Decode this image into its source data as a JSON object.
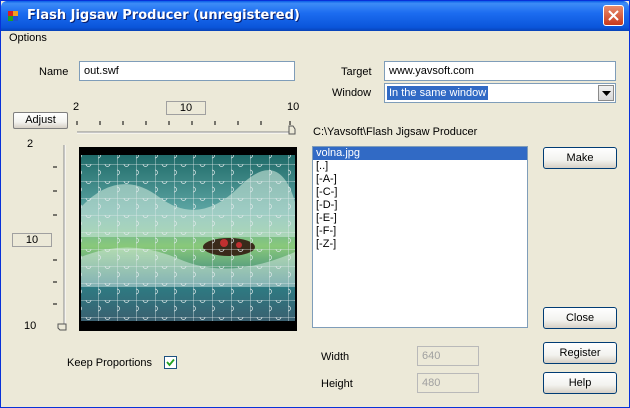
{
  "window": {
    "title": "Flash Jigsaw Producer (unregistered)"
  },
  "menu": {
    "options": "Options"
  },
  "name": {
    "label": "Name",
    "value": "out.swf"
  },
  "target": {
    "label": "Target",
    "value": "www.yavsoft.com"
  },
  "window_select": {
    "label": "Window",
    "selected": "In the same window"
  },
  "adjust_button": "Adjust",
  "horizontal_pieces": {
    "min": "2",
    "max": "10",
    "value": "10"
  },
  "vertical_pieces": {
    "min": "2",
    "max": "10",
    "value": "10"
  },
  "folder_path": "C:\\Yavsoft\\Flash Jigsaw Producer",
  "file_list": [
    "volna.jpg",
    "[..]",
    "[-A-]",
    "[-C-]",
    "[-D-]",
    "[-E-]",
    "[-F-]",
    "[-Z-]"
  ],
  "selected_file_index": 0,
  "buttons": {
    "make": "Make",
    "close": "Close",
    "register": "Register",
    "help": "Help"
  },
  "keep_proportions": {
    "label": "Keep Proportions",
    "checked": true
  },
  "width": {
    "label": "Width",
    "value": "640"
  },
  "height": {
    "label": "Height",
    "value": "480"
  },
  "colors": {
    "title_bar": "#0a55da",
    "selection": "#316ac5",
    "close_button": "#c8391c",
    "dialog": "#ece9d8"
  }
}
